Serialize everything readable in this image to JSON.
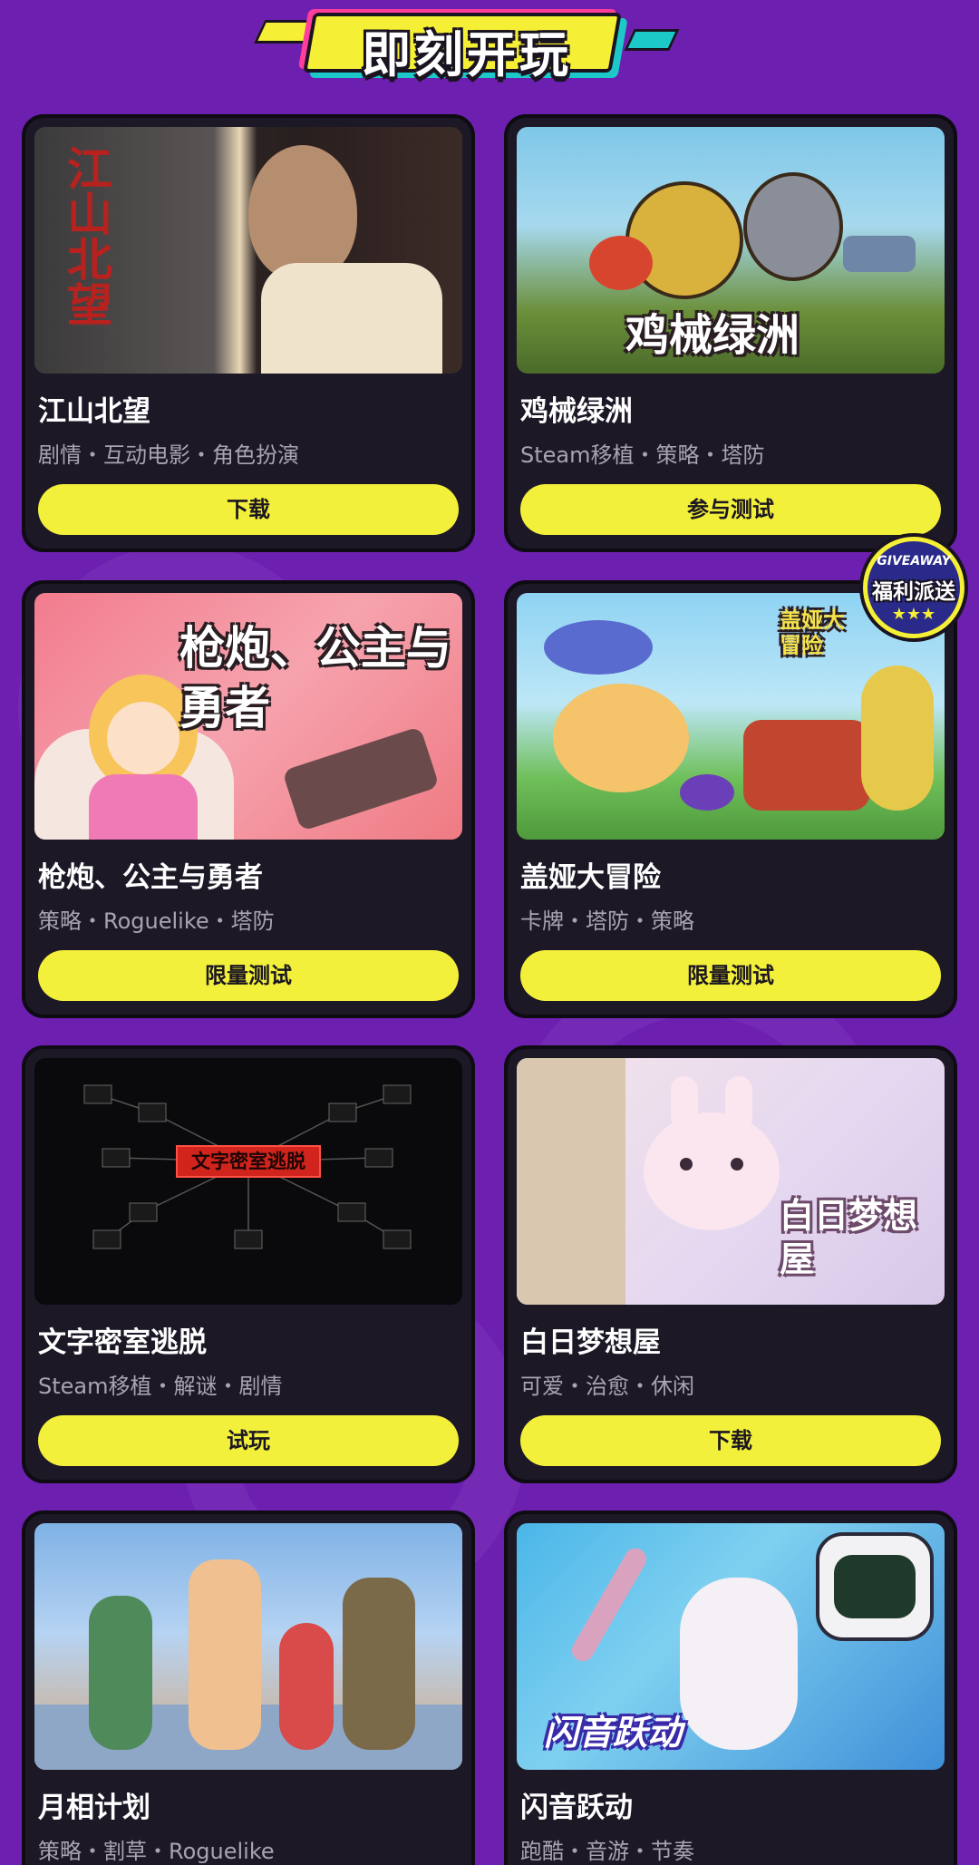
{
  "header": {
    "title": "即刻开玩"
  },
  "badge": {
    "line1": "GIVEAWAY",
    "line2": "福利派送",
    "stars": "★★★"
  },
  "games": [
    {
      "title": "江山北望",
      "tags": "剧情・互动电影・角色扮演",
      "action": "下载",
      "art_text": "江山北望"
    },
    {
      "title": "鸡械绿洲",
      "tags": "Steam移植・策略・塔防",
      "action": "参与测试",
      "art_text": "鸡械绿洲"
    },
    {
      "title": "枪炮、公主与勇者",
      "tags": "策略・Roguelike・塔防",
      "action": "限量测试",
      "art_text": "枪炮、公主与勇者"
    },
    {
      "title": "盖娅大冒险",
      "tags": "卡牌・塔防・策略",
      "action": "限量测试",
      "art_text": "盖娅大冒险"
    },
    {
      "title": "文字密室逃脱",
      "tags": "Steam移植・解谜・剧情",
      "action": "试玩",
      "art_text": "文字密室逃脱"
    },
    {
      "title": "白日梦想屋",
      "tags": "可爱・治愈・休闲",
      "action": "下载",
      "art_text": "白日梦想屋"
    },
    {
      "title": "月相计划",
      "tags": "策略・割草・Roguelike",
      "action": "",
      "art_text": ""
    },
    {
      "title": "闪音跃动",
      "tags": "跑酷・音游・节奏",
      "action": "",
      "art_text": "闪音跃动"
    }
  ],
  "colors": {
    "background": "#6d1fb0",
    "card": "#1d1826",
    "button": "#f3f03c",
    "tag_text": "#a9a3b3"
  }
}
